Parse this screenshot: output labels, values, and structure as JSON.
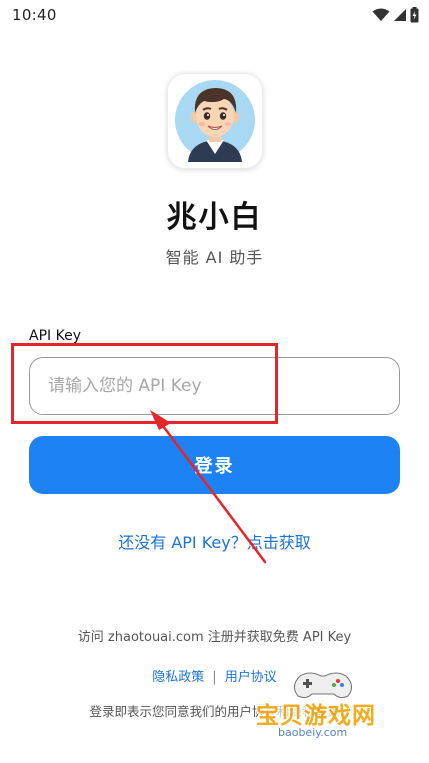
{
  "status_bar": {
    "time": "10:40",
    "icons": [
      "wifi-icon",
      "signal-icon",
      "battery-icon"
    ]
  },
  "app": {
    "name": "兆小白",
    "subtitle": "智能 AI 助手"
  },
  "form": {
    "label": "API Key",
    "placeholder": "请输入您的 API Key",
    "value": "",
    "login_label": "登录"
  },
  "links": {
    "get_key": "还没有 API Key？点击获取"
  },
  "footer": {
    "visit_text": "访问 zhaotouai.com 注册并获取免费 API Key",
    "privacy": "隐私政策",
    "separator": "|",
    "terms": "用户协议",
    "agreement": "登录即表示您同意我们的用户协议和隐私政策"
  },
  "watermark": {
    "title": "宝贝游戏网",
    "url": "baobeiy.com"
  },
  "colors": {
    "primary": "#1d83f5",
    "link": "#1a73d9",
    "annotation": "#e5252a"
  }
}
